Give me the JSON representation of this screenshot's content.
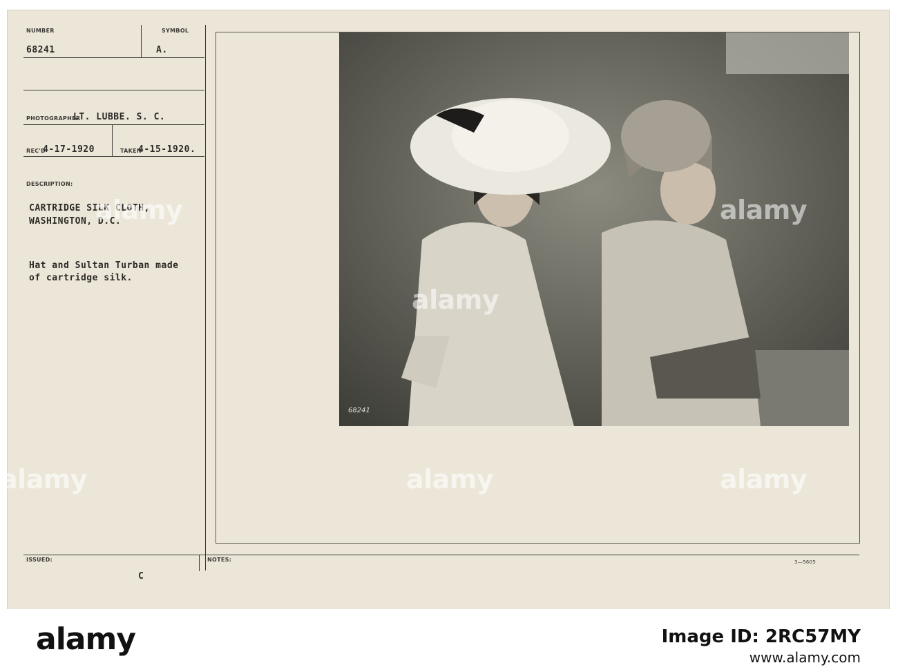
{
  "card": {
    "number_label": "NUMBER",
    "number": "68241",
    "symbol_label": "SYMBOL",
    "symbol": "A.",
    "photographer_label": "PHOTOGRAPHER",
    "photographer": "LT. LUBBE. S. C.",
    "recd_label": "REC'D",
    "recd": "4-17-1920",
    "taken_label": "TAKEN",
    "taken": "4-15-1920.",
    "description_label": "DESCRIPTION:",
    "description_line1": "CARTRIDGE SILK CLOTH,",
    "description_line2": "WASHINGTON, D.C.",
    "caption_line1": "Hat and Sultan Turban made",
    "caption_line2": "of cartridge silk.",
    "issued_label": "ISSUED:",
    "issued_mark": "C",
    "notes_label": "NOTES:",
    "form_code": "3—5605",
    "negative_number": "68241"
  },
  "watermark": {
    "text": "alamy"
  },
  "footer": {
    "brand": "alamy",
    "image_id": "Image ID: 2RC57MY",
    "url": "www.alamy.com"
  },
  "colors": {
    "card": "#ece6d8",
    "ink": "#2c2a27",
    "photo_shadow": "#3a3a34",
    "footer": "#ffffff"
  }
}
